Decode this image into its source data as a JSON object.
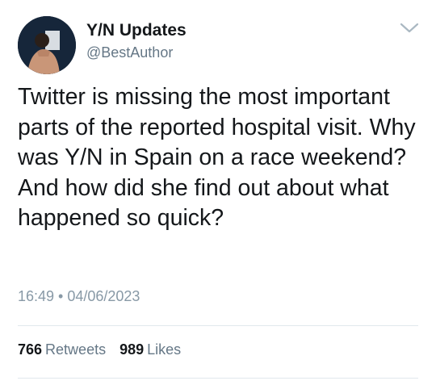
{
  "tweet": {
    "display_name": "Y/N Updates",
    "handle": "@BestAuthor",
    "text": "Twitter is missing the most important parts of the reported hospital visit. Why was Y/N in Spain on a race weekend? And how did she find out about what happened so quick?",
    "time": "16:49",
    "separator": "•",
    "date": "04/06/2023",
    "retweets_count": "766",
    "retweets_label": "Retweets",
    "likes_count": "989",
    "likes_label": "Likes",
    "menu_icon": "chevron-down-icon"
  },
  "colors": {
    "text": "#14171a",
    "secondary": "#657786",
    "divider": "#e1e8ed"
  }
}
